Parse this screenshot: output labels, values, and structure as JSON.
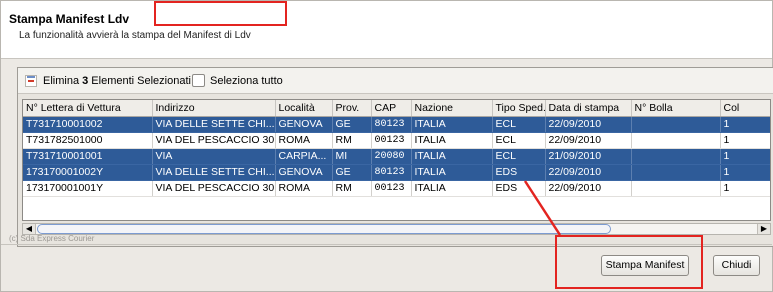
{
  "header": {
    "title": "Stampa Manifest Ldv",
    "subtitle": "La funzionalità avvierà la stampa del Manifest di Ldv"
  },
  "toolbar": {
    "delete_prefix": "Elimina ",
    "delete_count": "3",
    "delete_suffix": " Elementi Selezionati",
    "select_all_label": "Seleziona tutto",
    "select_all_checked": false
  },
  "table": {
    "columns": [
      "N° Lettera di Vettura",
      "Indirizzo",
      "Località",
      "Prov.",
      "CAP",
      "Nazione",
      "Tipo Sped.",
      "Data di stampa",
      "N° Bolla",
      "Col"
    ],
    "rows": [
      {
        "selected": true,
        "cells": [
          "T731710001002",
          "VIA DELLE SETTE CHI...",
          "GENOVA",
          "GE",
          "80123",
          "ITALIA",
          "ECL",
          "22/09/2010",
          "",
          "1"
        ]
      },
      {
        "selected": false,
        "cells": [
          "T731782501000",
          "VIA DEL PESCACCIO 30",
          "ROMA",
          "RM",
          "00123",
          "ITALIA",
          "ECL",
          "22/09/2010",
          "",
          "1"
        ]
      },
      {
        "selected": true,
        "cells": [
          "T731710001001",
          "VIA",
          "CARPIA...",
          "MI",
          "20080",
          "ITALIA",
          "ECL",
          "21/09/2010",
          "",
          "1"
        ]
      },
      {
        "selected": true,
        "cells": [
          "173170001002Y",
          "VIA DELLE SETTE CHI...",
          "GENOVA",
          "GE",
          "80123",
          "ITALIA",
          "EDS",
          "22/09/2010",
          "",
          "1"
        ]
      },
      {
        "selected": false,
        "cells": [
          "173170001001Y",
          "VIA DEL PESCACCIO 30",
          "ROMA",
          "RM",
          "00123",
          "ITALIA",
          "EDS",
          "22/09/2010",
          "",
          "1"
        ]
      }
    ]
  },
  "footer": {
    "copyright": "(c) Sda Express Courier",
    "print_button": "Stampa Manifest",
    "close_button": "Chiudi"
  },
  "colors": {
    "selected_row": "#2e5b98",
    "highlight": "#e32420"
  }
}
